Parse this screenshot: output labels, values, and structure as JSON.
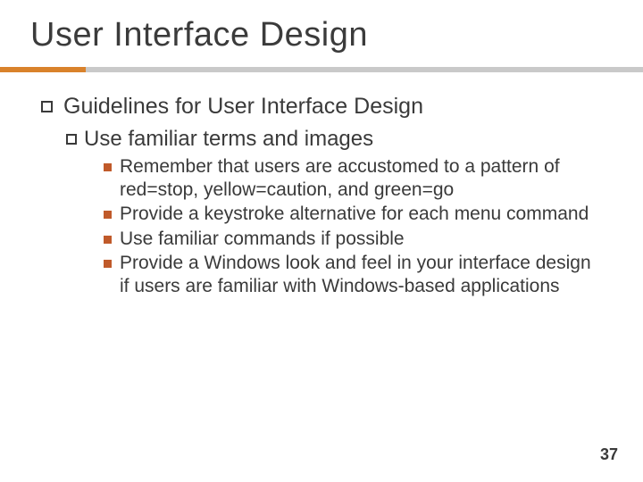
{
  "title": "User Interface Design",
  "lvl1": "Guidelines for User Interface Design",
  "lvl2": "Use familiar terms and images",
  "lvl3": [
    "Remember that users are accustomed to a pattern of red=stop, yellow=caution, and green=go",
    "Provide a keystroke alternative for each menu command",
    "Use familiar commands if possible",
    "Provide a Windows look and feel in your interface design if users are familiar with Windows-based applications"
  ],
  "page_number": "37"
}
